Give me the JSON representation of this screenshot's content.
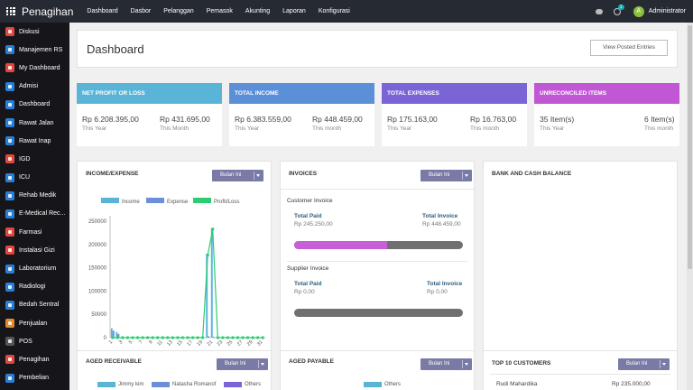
{
  "topbar": {
    "brand": "Penagihan",
    "menu": [
      "Dashboard",
      "Dasbor",
      "Pelanggan",
      "Pemasok",
      "Akunting",
      "Laporan",
      "Konfigurasi"
    ],
    "activity_badge": "1",
    "user_initial": "A",
    "user_name": "Administrator"
  },
  "sidebar": {
    "items": [
      {
        "label": "Diskusi",
        "color": "#e0483d"
      },
      {
        "label": "Manajemen RS",
        "color": "#2a7fd4"
      },
      {
        "label": "My Dashboard",
        "color": "#e0483d"
      },
      {
        "label": "Admisi",
        "color": "#2a7fd4"
      },
      {
        "label": "Dashboard",
        "color": "#2a7fd4"
      },
      {
        "label": "Rawat Jalan",
        "color": "#2a7fd4"
      },
      {
        "label": "Rawat Inap",
        "color": "#2a7fd4"
      },
      {
        "label": "IGD",
        "color": "#e0483d"
      },
      {
        "label": "ICU",
        "color": "#2a7fd4"
      },
      {
        "label": "Rehab Medik",
        "color": "#2a7fd4"
      },
      {
        "label": "E-Medical Rec...",
        "color": "#2a7fd4"
      },
      {
        "label": "Farmasi",
        "color": "#e0483d"
      },
      {
        "label": "Instalasi Gizi",
        "color": "#e0483d"
      },
      {
        "label": "Laboratorium",
        "color": "#2a7fd4"
      },
      {
        "label": "Radiologi",
        "color": "#2a7fd4"
      },
      {
        "label": "Bedah Sentral",
        "color": "#2a7fd4"
      },
      {
        "label": "Penjualan",
        "color": "#e08a2d"
      },
      {
        "label": "POS",
        "color": "#555555"
      },
      {
        "label": "Penagihan",
        "color": "#e0483d"
      },
      {
        "label": "Pembelian",
        "color": "#2a7fd4"
      }
    ]
  },
  "header": {
    "title": "Dashboard",
    "button": "View Posted Entries"
  },
  "kpis": [
    {
      "title": "NET PROFIT OR LOSS",
      "color": "#5ab4d8",
      "left_value": "Rp 6.208.395,00",
      "left_sub": "This Year",
      "right_value": "Rp 431.695,00",
      "right_sub": "This Month"
    },
    {
      "title": "TOTAL INCOME",
      "color": "#5b8fd8",
      "left_value": "Rp 6.383.559,00",
      "left_sub": "This Year",
      "right_value": "Rp 448.459,00",
      "right_sub": "This month"
    },
    {
      "title": "TOTAL EXPENSES",
      "color": "#7b64d6",
      "left_value": "Rp 175.163,00",
      "left_sub": "This Year",
      "right_value": "Rp 16.763,00",
      "right_sub": "This month"
    },
    {
      "title": "UNRECONCILED ITEMS",
      "color": "#c257d6",
      "left_value": "35 Item(s)",
      "left_sub": "This Year",
      "right_value": "6 Item(s)",
      "right_sub": "This month"
    }
  ],
  "income_expense": {
    "title": "INCOME/EXPENSE",
    "dropdown": "Bulan Ini"
  },
  "chart_data": {
    "type": "line",
    "title": "",
    "xlabel": "",
    "ylabel": "",
    "x": [
      1,
      2,
      3,
      4,
      5,
      6,
      7,
      8,
      9,
      10,
      11,
      12,
      13,
      14,
      15,
      16,
      17,
      18,
      19,
      20,
      21,
      22,
      23,
      24,
      25,
      26,
      27,
      28,
      29,
      30,
      31
    ],
    "x_ticks": [
      "1",
      "3",
      "5",
      "7",
      "9",
      "11",
      "13",
      "15",
      "17",
      "19",
      "21",
      "23",
      "25",
      "27",
      "29",
      "31"
    ],
    "y_ticks": [
      "0",
      "50000",
      "100000",
      "150000",
      "200000",
      "250000"
    ],
    "ylim": [
      0,
      250000
    ],
    "legend": "top-center",
    "series": [
      {
        "name": "Income",
        "type": "bar",
        "color": "#5ab4d8",
        "values": [
          20000,
          12000,
          0,
          0,
          0,
          0,
          0,
          0,
          0,
          0,
          0,
          0,
          0,
          0,
          0,
          0,
          0,
          0,
          0,
          180000,
          235000,
          0,
          0,
          0,
          0,
          0,
          0,
          0,
          0,
          0,
          0
        ]
      },
      {
        "name": "Expense",
        "type": "bar",
        "color": "#6b8fd8",
        "values": [
          15000,
          8000,
          0,
          0,
          0,
          0,
          0,
          0,
          0,
          0,
          0,
          0,
          0,
          0,
          0,
          0,
          0,
          0,
          0,
          3000,
          2000,
          0,
          0,
          0,
          0,
          0,
          0,
          0,
          0,
          0,
          0
        ]
      },
      {
        "name": "Profit/Loss",
        "type": "line",
        "color": "#2ecc71",
        "values": [
          0,
          0,
          0,
          0,
          0,
          0,
          0,
          0,
          0,
          0,
          0,
          0,
          0,
          0,
          0,
          0,
          0,
          0,
          0,
          177000,
          233000,
          0,
          0,
          0,
          0,
          0,
          0,
          0,
          0,
          0,
          0
        ]
      }
    ]
  },
  "invoices": {
    "title": "INVOICES",
    "dropdown": "Bulan Ini",
    "customer": {
      "label": "Customer Invoice",
      "paid_key": "Total Paid",
      "paid_value": "Rp 245.250,00",
      "total_key": "Total Invoice",
      "total_value": "Rp 448.459,00",
      "paid_fraction": 0.55
    },
    "supplier": {
      "label": "Supplier Invoice",
      "paid_key": "Total Paid",
      "paid_value": "Rp 0,00",
      "total_key": "Total Invoice",
      "total_value": "Rp 0,00",
      "paid_fraction": 0
    }
  },
  "bank_cash": {
    "title": "BANK AND CASH BALANCE"
  },
  "aged_receivable": {
    "title": "AGED RECEIVABLE",
    "dropdown": "Bulan Ini",
    "legend": [
      {
        "name": "Jimmy kim",
        "color": "#5ab4d8"
      },
      {
        "name": "Natasha Romanof",
        "color": "#6b8fd8"
      },
      {
        "name": "Others",
        "color": "#7b64d6"
      }
    ]
  },
  "aged_payable": {
    "title": "AGED PAYABLE",
    "dropdown": "Bulan Ini",
    "legend": [
      {
        "name": "Others",
        "color": "#5ab4d8"
      }
    ]
  },
  "top_customers": {
    "title": "TOP 10 CUSTOMERS",
    "dropdown": "Bulan Ini",
    "rows": [
      {
        "name": "Rudi Mahardika",
        "amount": "Rp 235.000,00"
      }
    ]
  }
}
